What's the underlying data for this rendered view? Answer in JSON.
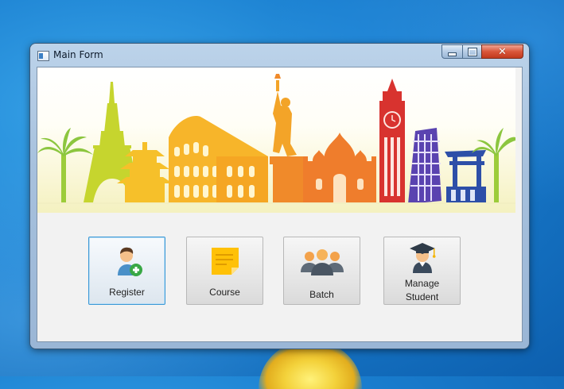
{
  "desktop": {
    "background_color": "#1a7fd0"
  },
  "window": {
    "title": "Main Form",
    "caption_buttons": {
      "minimize": "—",
      "maximize": "□",
      "close": "✕"
    }
  },
  "banner": {
    "subject": "world landmarks skyline",
    "landmarks": [
      "palm-tree",
      "eiffel-tower",
      "pagoda",
      "colosseum",
      "statue-of-liberty",
      "taj-mahal",
      "big-ben",
      "leaning-tower-of-pisa",
      "torii-gate",
      "palm-tree"
    ]
  },
  "actions": [
    {
      "label": "Register",
      "icon": "register-user-icon",
      "focused": true
    },
    {
      "label": "Course",
      "icon": "sticky-note-icon",
      "focused": false
    },
    {
      "label": "Batch",
      "icon": "group-icon",
      "focused": false
    },
    {
      "label": "Manage\nStudent",
      "icon": "graduate-icon",
      "focused": false
    }
  ],
  "colors": {
    "accent_focus": "#3a98d6",
    "close_button": "#d9563a",
    "banner_green": "#b8d430",
    "banner_yellow": "#f2c12a",
    "banner_orange": "#f08a2a",
    "banner_red": "#d8332f",
    "banner_purple": "#5a43b0",
    "banner_blue": "#2d4fa8"
  }
}
